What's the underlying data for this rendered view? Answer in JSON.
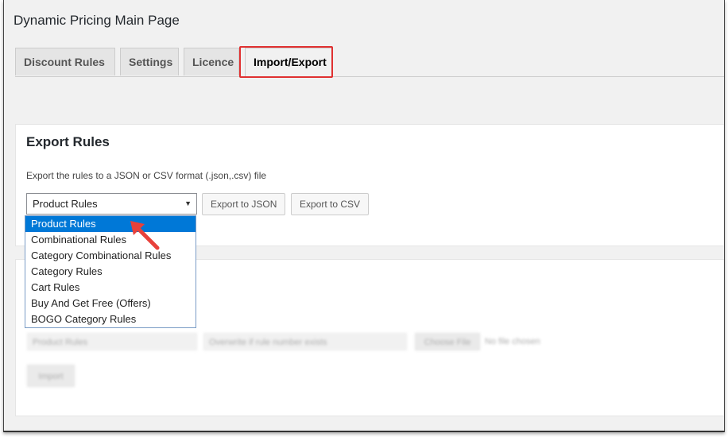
{
  "page": {
    "title": "Dynamic Pricing Main Page"
  },
  "tabs": [
    {
      "label": "Discount Rules",
      "active": false
    },
    {
      "label": "Settings",
      "active": false
    },
    {
      "label": "Licence",
      "active": false
    },
    {
      "label": "Import/Export",
      "active": true
    }
  ],
  "export": {
    "heading": "Export Rules",
    "description": "Export the rules to a JSON or CSV format (.json,.csv) file",
    "select_value": "Product Rules",
    "json_button": "Export to JSON",
    "csv_button": "Export to CSV"
  },
  "dropdown": {
    "options": [
      "Product Rules",
      "Combinational Rules",
      "Category Combinational Rules",
      "Category Rules",
      "Cart Rules",
      "Buy And Get Free (Offers)",
      "BOGO Category Rules"
    ],
    "selected_index": 0
  },
  "import_blurred": {
    "select_value": "Product Rules",
    "mode_value": "Overwrite if rule number exists",
    "file_button": "Choose File",
    "file_status": "No file chosen",
    "import_button": "Import"
  },
  "colors": {
    "highlight": "#e03131",
    "selected_option": "#0078d7",
    "pointer_arrow": "#e8413b"
  }
}
